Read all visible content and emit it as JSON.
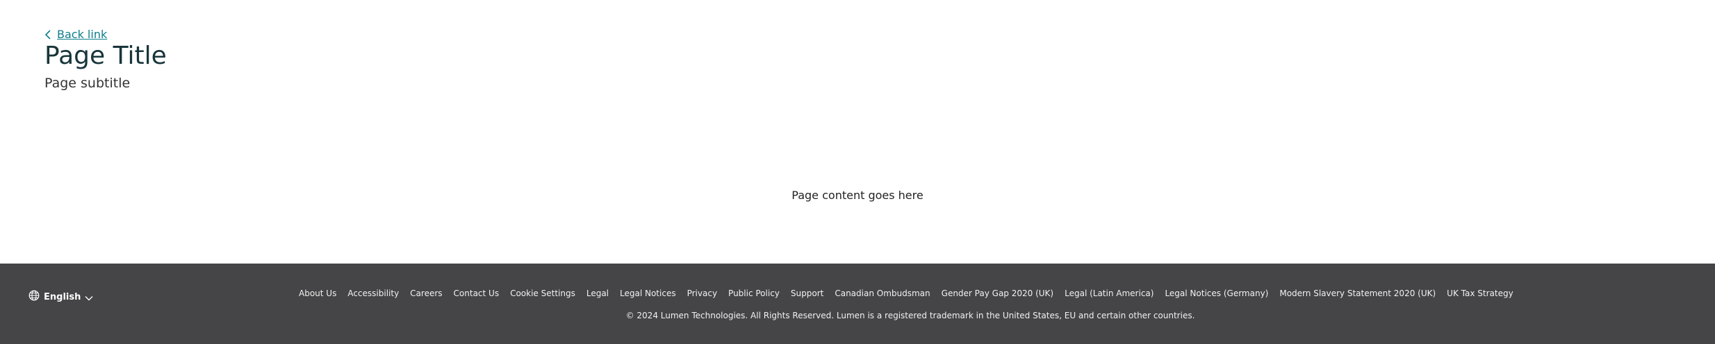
{
  "header": {
    "back_link": "Back link",
    "title": "Page Title",
    "subtitle": "Page subtitle"
  },
  "main": {
    "content_placeholder": "Page content goes here"
  },
  "footer": {
    "language": {
      "label": "English",
      "icon": "globe-icon",
      "dropdown_icon": "chevron-down-icon"
    },
    "links": [
      "About Us",
      "Accessibility",
      "Careers",
      "Contact Us",
      "Cookie Settings",
      "Legal",
      "Legal Notices",
      "Privacy",
      "Public Policy",
      "Support",
      "Canadian Ombudsman",
      "Gender Pay Gap 2020 (UK)",
      "Legal (Latin America)",
      "Legal Notices (Germany)",
      "Modern Slavery Statement 2020 (UK)",
      "UK Tax Strategy"
    ],
    "copyright": "© 2024 Lumen Technologies. All Rights Reserved. Lumen is a registered trademark in the United States, EU and certain other countries."
  },
  "colors": {
    "link": "#0f7d8a",
    "title": "#17353a",
    "footer_background": "#454446",
    "footer_text": "#ffffff"
  }
}
